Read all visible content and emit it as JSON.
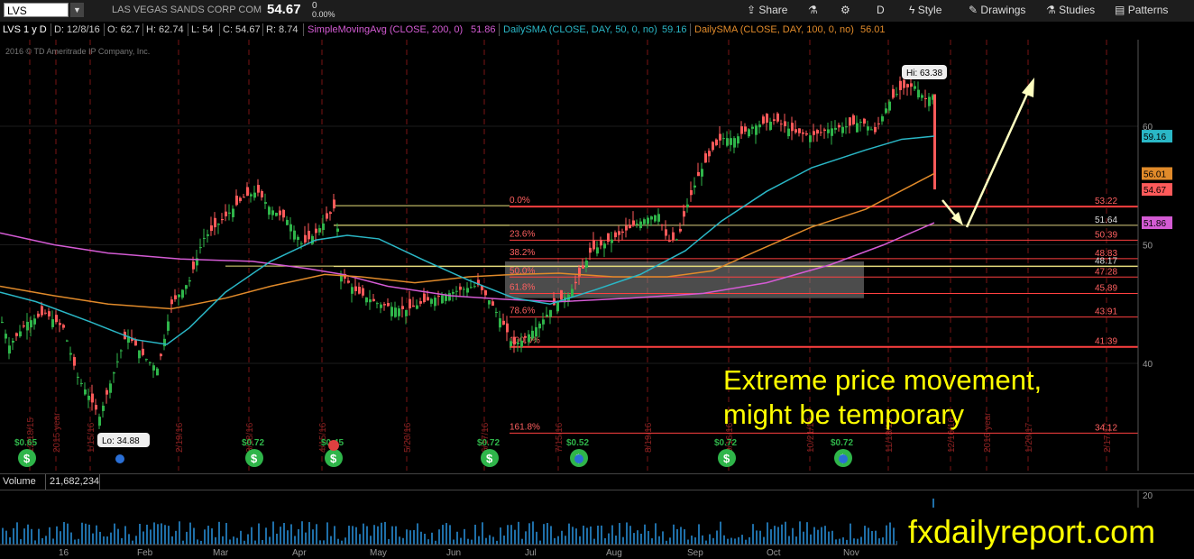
{
  "toolbar": {
    "symbol": "LVS",
    "company": "LAS VEGAS SANDS CORP COM",
    "last_price": "54.67",
    "change": "0",
    "change_pct": "0.00%",
    "share_label": "Share",
    "period_label": "D",
    "style_label": "Style",
    "drawings_label": "Drawings",
    "studies_label": "Studies",
    "patterns_label": "Patterns"
  },
  "info": {
    "chart_name": "LVS 1 y D",
    "date": "D: 12/8/16",
    "open": "O: 62.7",
    "high": "H: 62.74",
    "low": "L: 54",
    "close": "C: 54.67",
    "range": "R: 8.74",
    "sma200_name": "SimpleMovingAvg (CLOSE, 200, 0)",
    "sma200_val": "51.86",
    "sma50_name": "DailySMA (CLOSE, DAY, 50, 0, no)",
    "sma50_val": "59.16",
    "sma100_name": "DailySMA (CLOSE, DAY, 100, 0, no)",
    "sma100_val": "56.01"
  },
  "copyright": "2016 © TD Ameritrade IP Company, Inc.",
  "volume_label": "Volume",
  "volume_value": "21,682,234",
  "annotation_line1": "Extreme price movement,",
  "annotation_line2": "might be temporary",
  "watermark": "fxdailyreport.com",
  "colors": {
    "up": "#2fb54a",
    "down": "#ff5a5a",
    "sma50": "#2ab7c6",
    "sma100": "#e08a2a",
    "sma200": "#d45bd4",
    "fib_line": "#ff4040",
    "arrow": "#ffffc0",
    "annotation": "#ffff00"
  },
  "chart_data": {
    "type": "candlestick",
    "ylim": [
      33,
      67
    ],
    "y_ticks": [
      40,
      50,
      60
    ],
    "x_tick_labels": [
      "16",
      "Feb",
      "Mar",
      "Apr",
      "May",
      "Jun",
      "Jul",
      "Aug",
      "Sep",
      "Oct",
      "Nov"
    ],
    "price_markers": [
      {
        "value": 59.16,
        "label": "59.16",
        "color": "#2ab7c6"
      },
      {
        "value": 56.01,
        "label": "56.01",
        "color": "#e08a2a"
      },
      {
        "value": 54.67,
        "label": "54.67",
        "color": "#ff5a5a"
      },
      {
        "value": 51.86,
        "label": "51.86",
        "color": "#d45bd4"
      }
    ],
    "hi_label": "Hi: 63.38",
    "lo_label": "Lo: 34.88",
    "fib_levels": [
      {
        "pct": "0.0%",
        "price": 53.22,
        "label": "53.22"
      },
      {
        "pct": "23.6%",
        "price": 50.39,
        "label": "50.39"
      },
      {
        "pct": "38.2%",
        "price": 48.83,
        "label": "48.83"
      },
      {
        "pct": "50.0%",
        "price": 47.28,
        "label": "47.28"
      },
      {
        "pct": "61.8%",
        "price": 45.89,
        "label": "45.89"
      },
      {
        "pct": "78.6%",
        "price": 43.91,
        "label": "43.91"
      },
      {
        "pct": "100.0%",
        "price": 41.39,
        "label": "41.39"
      },
      {
        "pct": "161.8%",
        "price": 34.12,
        "label": "34.12"
      }
    ],
    "extra_levels": [
      {
        "price": 51.64,
        "label": "51.64"
      },
      {
        "price": 48.17,
        "label": "48.17"
      }
    ],
    "dividends": [
      {
        "label": "$0.65"
      },
      {
        "label": "$0.72"
      },
      {
        "label": "$0.45"
      },
      {
        "label": "$0.72"
      },
      {
        "label": "$0.52"
      },
      {
        "label": "$0.72"
      },
      {
        "label": "$0.72"
      }
    ],
    "vertical_date_labels": [
      "12/18/15",
      "2015 year",
      "1/15/16",
      "2/19/16",
      "3/18/16",
      "4/15/16",
      "5/20/16",
      "6/17/16",
      "7/15/16",
      "8/19/16",
      "9/16/16",
      "10/21/16",
      "11/18/16",
      "12/16/16",
      "2016 year",
      "1/20/17",
      "2/17/17"
    ],
    "volume_axis_tick": "20"
  }
}
